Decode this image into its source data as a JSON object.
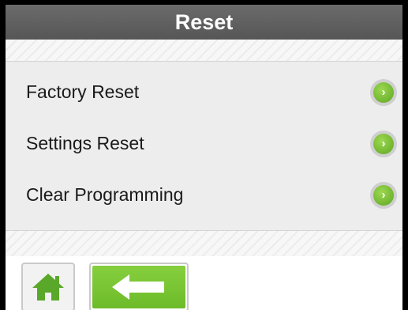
{
  "header": {
    "title": "Reset"
  },
  "menu": {
    "items": [
      {
        "label": "Factory Reset",
        "icon": "chevron-right-icon"
      },
      {
        "label": "Settings Reset",
        "icon": "chevron-right-icon"
      },
      {
        "label": "Clear Programming",
        "icon": "chevron-right-icon"
      }
    ]
  },
  "footer": {
    "home_icon": "home-icon",
    "back_icon": "arrow-left-icon"
  },
  "colors": {
    "header_bg": "#5f5f5f",
    "accent_green": "#6dbb29",
    "background": "#ededed"
  }
}
